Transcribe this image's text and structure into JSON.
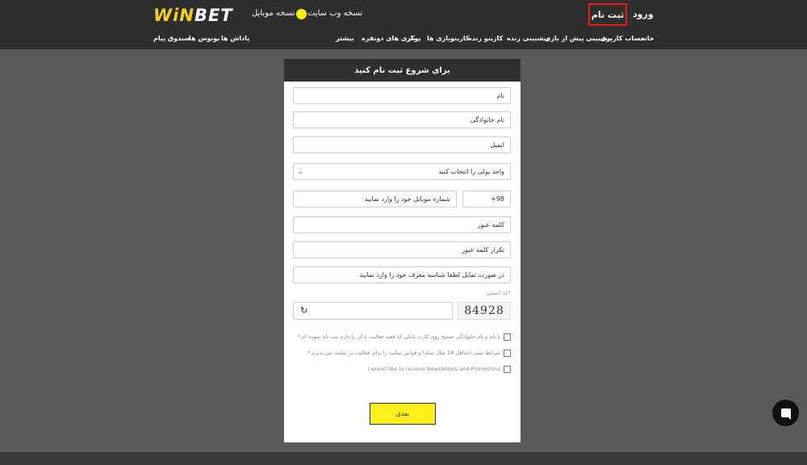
{
  "header": {
    "logo_part1": "WiN",
    "logo_part2": "BET",
    "web_version": "نسخه وب سایت",
    "mobile_version": "نسخه موبایل",
    "register": "ثبت نام",
    "login": "ورود"
  },
  "nav": {
    "items": [
      "خانه",
      "حساب کاربری",
      "پیشبینی پیش از بازی",
      "پیشبینی زنده",
      "کازینو زنده",
      "کازینو",
      "بازی ها",
      "پوکر",
      "بازی های دونفره",
      "بیشتر",
      "پاداش ها",
      "بونوس ها",
      "صندوق پیام"
    ]
  },
  "form": {
    "title": "برای شروع ثبت نام کنید",
    "first_name": "نام",
    "last_name": "نام خانوادگی",
    "email": "ایمیل",
    "currency": "واحد پولی را انتخاب کنید",
    "phone_code": "98+",
    "phone": "شماره موبایل خود را وارد نمایید",
    "password": "کلمه عبور",
    "password_repeat": "تکرار کلمه عبور",
    "referral": "در صورت تمایل لطفا شناسه معرف خود را وارد نمایید",
    "captcha_label": "*کد امنیتی",
    "captcha_text": "84928",
    "check1": "با نام و نام خانوادگی صحیح روی کارت بانکی که قصد فعالیت با آن را دارم ثبت نام نموده ام.*",
    "check2": "شرایط سنی (حداقل 18 سال تمام) و قوانین سایت را برای فعالیت در سایت می پذیرم.*",
    "check3": "I would like to receive Newsletters and Promotions",
    "next": "بعدی"
  },
  "colors": {
    "accent": "#ffef00",
    "topbar": "#2e2e2e",
    "register_outline": "#e41b1b"
  },
  "icons": {
    "refresh": "refresh-icon",
    "chat": "chat-icon",
    "chevron": "chevron-down-icon"
  }
}
